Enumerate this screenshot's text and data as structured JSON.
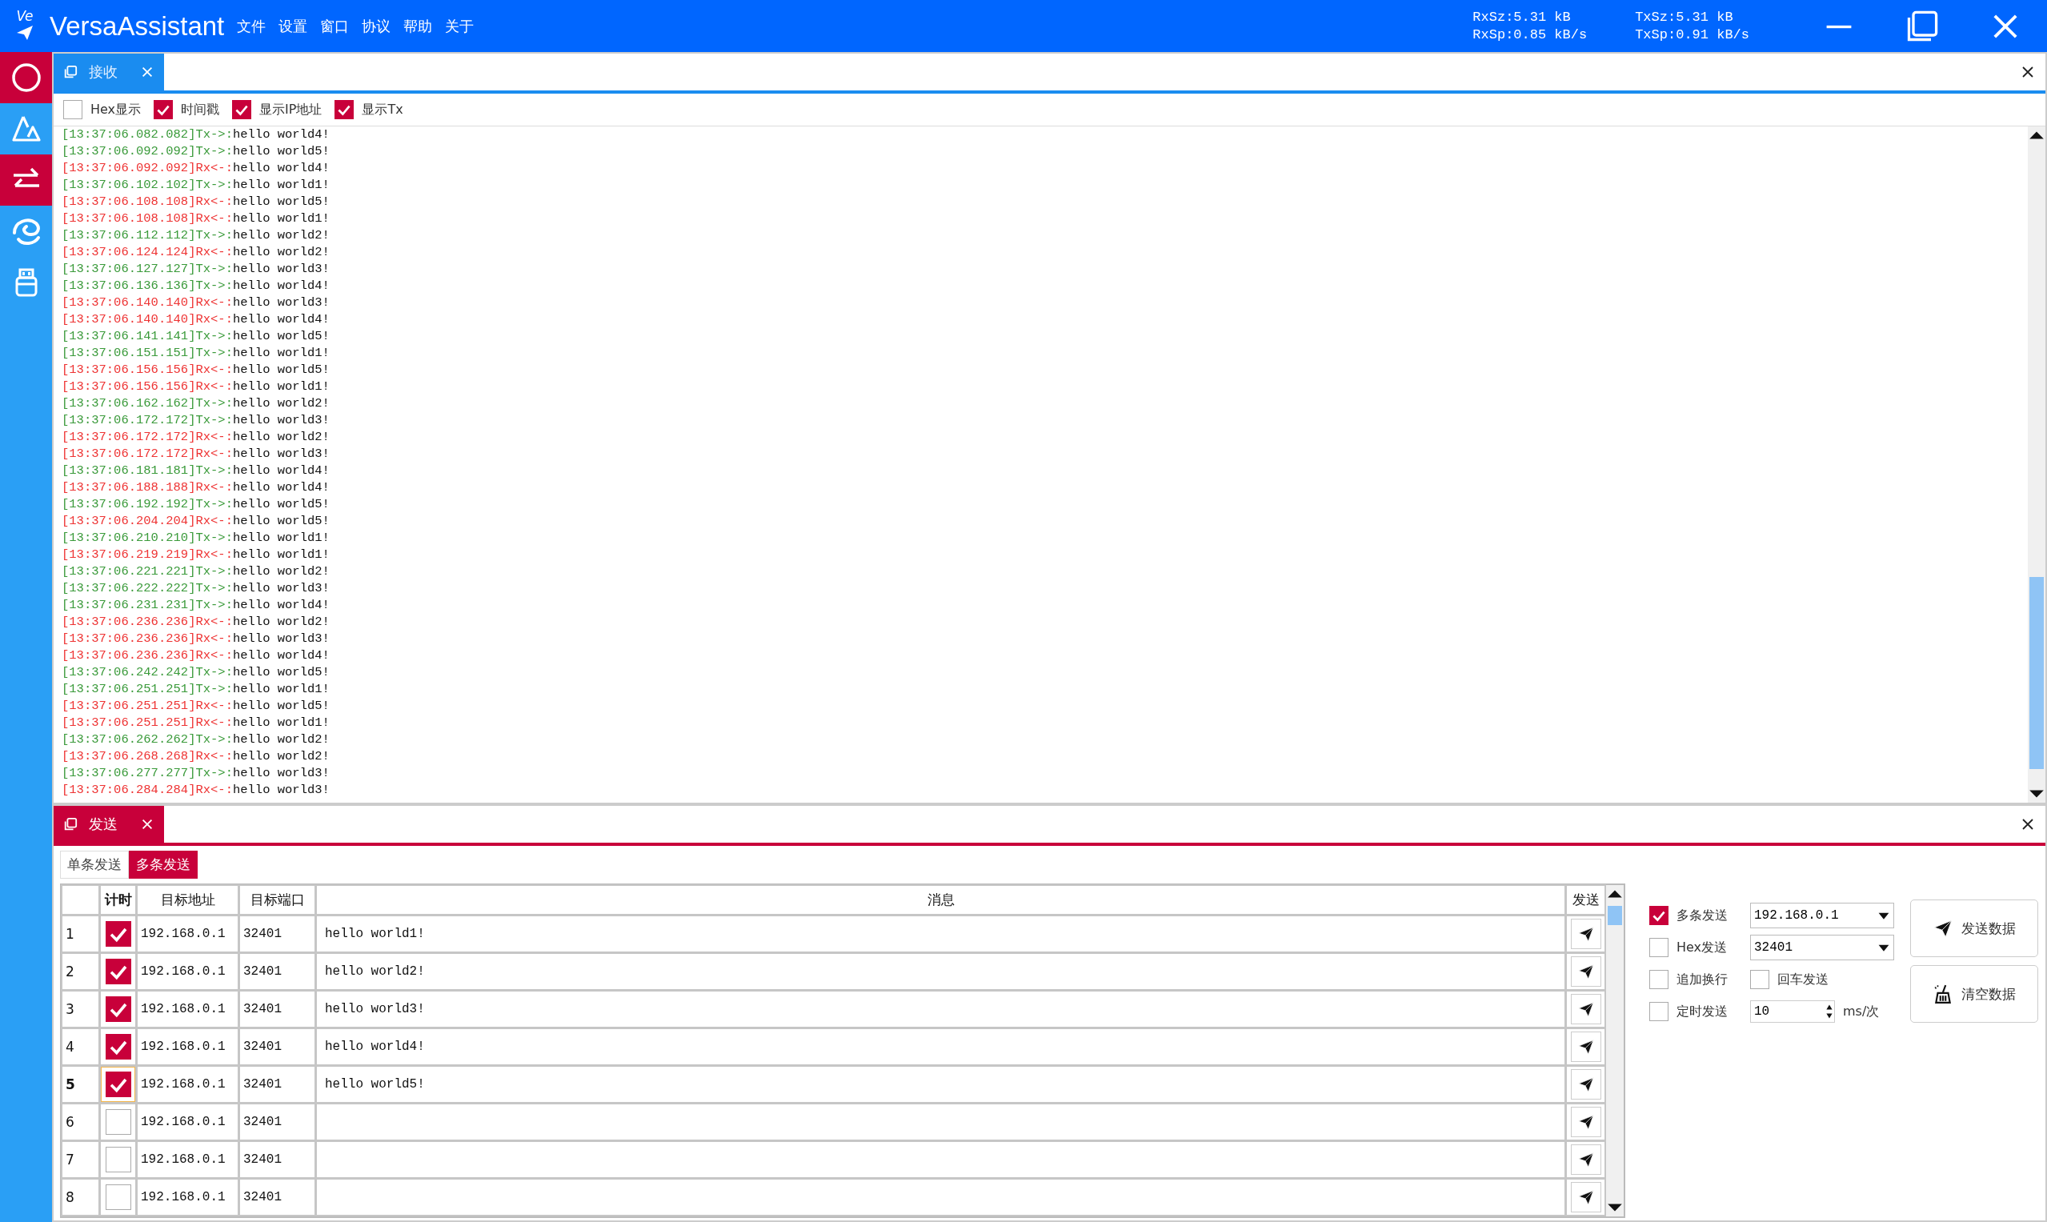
{
  "window": {
    "title": "VersaAssistant",
    "logo_text": "Ve"
  },
  "menu": [
    "文件",
    "设置",
    "窗口",
    "协议",
    "帮助",
    "关于"
  ],
  "stats": [
    {
      "lines": [
        "RxSz:5.31 kB",
        "RxSp:0.85 kB/s"
      ]
    },
    {
      "lines": [
        "TxSz:5.31 kB",
        "TxSp:0.91 kB/s"
      ]
    }
  ],
  "sidebar": {
    "items": [
      {
        "kind": "record",
        "selected": true
      },
      {
        "kind": "triangle",
        "selected": false
      },
      {
        "kind": "transfer",
        "selected": true
      },
      {
        "kind": "swirl",
        "selected": false
      },
      {
        "kind": "plug",
        "selected": false
      }
    ]
  },
  "receive": {
    "tab": {
      "label": "接收",
      "focused": false
    },
    "options": [
      {
        "label": "Hex显示",
        "checked": false
      },
      {
        "label": "时间戳",
        "checked": true
      },
      {
        "label": "显示IP地址",
        "checked": true
      },
      {
        "label": "显示Tx",
        "checked": true
      }
    ],
    "log": [
      {
        "kind": "tx",
        "stamp": "[13:37:06.082.082]Tx->:",
        "message": "hello world4!"
      },
      {
        "kind": "tx",
        "stamp": "[13:37:06.092.092]Tx->:",
        "message": "hello world5!"
      },
      {
        "kind": "rx",
        "stamp": "[13:37:06.092.092]Rx<-:",
        "message": "hello world4!"
      },
      {
        "kind": "tx",
        "stamp": "[13:37:06.102.102]Tx->:",
        "message": "hello world1!"
      },
      {
        "kind": "rx",
        "stamp": "[13:37:06.108.108]Rx<-:",
        "message": "hello world5!"
      },
      {
        "kind": "rx",
        "stamp": "[13:37:06.108.108]Rx<-:",
        "message": "hello world1!"
      },
      {
        "kind": "tx",
        "stamp": "[13:37:06.112.112]Tx->:",
        "message": "hello world2!"
      },
      {
        "kind": "rx",
        "stamp": "[13:37:06.124.124]Rx<-:",
        "message": "hello world2!"
      },
      {
        "kind": "tx",
        "stamp": "[13:37:06.127.127]Tx->:",
        "message": "hello world3!"
      },
      {
        "kind": "tx",
        "stamp": "[13:37:06.136.136]Tx->:",
        "message": "hello world4!"
      },
      {
        "kind": "rx",
        "stamp": "[13:37:06.140.140]Rx<-:",
        "message": "hello world3!"
      },
      {
        "kind": "rx",
        "stamp": "[13:37:06.140.140]Rx<-:",
        "message": "hello world4!"
      },
      {
        "kind": "tx",
        "stamp": "[13:37:06.141.141]Tx->:",
        "message": "hello world5!"
      },
      {
        "kind": "tx",
        "stamp": "[13:37:06.151.151]Tx->:",
        "message": "hello world1!"
      },
      {
        "kind": "rx",
        "stamp": "[13:37:06.156.156]Rx<-:",
        "message": "hello world5!"
      },
      {
        "kind": "rx",
        "stamp": "[13:37:06.156.156]Rx<-:",
        "message": "hello world1!"
      },
      {
        "kind": "tx",
        "stamp": "[13:37:06.162.162]Tx->:",
        "message": "hello world2!"
      },
      {
        "kind": "tx",
        "stamp": "[13:37:06.172.172]Tx->:",
        "message": "hello world3!"
      },
      {
        "kind": "rx",
        "stamp": "[13:37:06.172.172]Rx<-:",
        "message": "hello world2!"
      },
      {
        "kind": "rx",
        "stamp": "[13:37:06.172.172]Rx<-:",
        "message": "hello world3!"
      },
      {
        "kind": "tx",
        "stamp": "[13:37:06.181.181]Tx->:",
        "message": "hello world4!"
      },
      {
        "kind": "rx",
        "stamp": "[13:37:06.188.188]Rx<-:",
        "message": "hello world4!"
      },
      {
        "kind": "tx",
        "stamp": "[13:37:06.192.192]Tx->:",
        "message": "hello world5!"
      },
      {
        "kind": "rx",
        "stamp": "[13:37:06.204.204]Rx<-:",
        "message": "hello world5!"
      },
      {
        "kind": "tx",
        "stamp": "[13:37:06.210.210]Tx->:",
        "message": "hello world1!"
      },
      {
        "kind": "rx",
        "stamp": "[13:37:06.219.219]Rx<-:",
        "message": "hello world1!"
      },
      {
        "kind": "tx",
        "stamp": "[13:37:06.221.221]Tx->:",
        "message": "hello world2!"
      },
      {
        "kind": "tx",
        "stamp": "[13:37:06.222.222]Tx->:",
        "message": "hello world3!"
      },
      {
        "kind": "tx",
        "stamp": "[13:37:06.231.231]Tx->:",
        "message": "hello world4!"
      },
      {
        "kind": "rx",
        "stamp": "[13:37:06.236.236]Rx<-:",
        "message": "hello world2!"
      },
      {
        "kind": "rx",
        "stamp": "[13:37:06.236.236]Rx<-:",
        "message": "hello world3!"
      },
      {
        "kind": "rx",
        "stamp": "[13:37:06.236.236]Rx<-:",
        "message": "hello world4!"
      },
      {
        "kind": "tx",
        "stamp": "[13:37:06.242.242]Tx->:",
        "message": "hello world5!"
      },
      {
        "kind": "tx",
        "stamp": "[13:37:06.251.251]Tx->:",
        "message": "hello world1!"
      },
      {
        "kind": "rx",
        "stamp": "[13:37:06.251.251]Rx<-:",
        "message": "hello world5!"
      },
      {
        "kind": "rx",
        "stamp": "[13:37:06.251.251]Rx<-:",
        "message": "hello world1!"
      },
      {
        "kind": "tx",
        "stamp": "[13:37:06.262.262]Tx->:",
        "message": "hello world2!"
      },
      {
        "kind": "rx",
        "stamp": "[13:37:06.268.268]Rx<-:",
        "message": "hello world2!"
      },
      {
        "kind": "tx",
        "stamp": "[13:37:06.277.277]Tx->:",
        "message": "hello world3!"
      },
      {
        "kind": "rx",
        "stamp": "[13:37:06.284.284]Rx<-:",
        "message": "hello world3!"
      }
    ]
  },
  "send": {
    "tab": {
      "label": "发送",
      "focused": true
    },
    "modes": [
      {
        "label": "单条发送",
        "selected": false
      },
      {
        "label": "多条发送",
        "selected": true
      }
    ],
    "table": {
      "columns": [
        "计时",
        "目标地址",
        "目标端口",
        "消息",
        "发送"
      ],
      "rows": [
        {
          "index": "1",
          "timed": true,
          "address": "192.168.0.1",
          "port": "32401",
          "message": "hello world1!",
          "current": false
        },
        {
          "index": "2",
          "timed": true,
          "address": "192.168.0.1",
          "port": "32401",
          "message": "hello world2!",
          "current": false
        },
        {
          "index": "3",
          "timed": true,
          "address": "192.168.0.1",
          "port": "32401",
          "message": "hello world3!",
          "current": false
        },
        {
          "index": "4",
          "timed": true,
          "address": "192.168.0.1",
          "port": "32401",
          "message": "hello world4!",
          "current": false
        },
        {
          "index": "5",
          "timed": true,
          "address": "192.168.0.1",
          "port": "32401",
          "message": "hello world5!",
          "current": true
        },
        {
          "index": "6",
          "timed": false,
          "address": "192.168.0.1",
          "port": "32401",
          "current": false
        },
        {
          "index": "7",
          "timed": false,
          "address": "192.168.0.1",
          "port": "32401",
          "current": false
        },
        {
          "index": "8",
          "timed": false,
          "address": "192.168.0.1",
          "port": "32401",
          "current": false
        }
      ]
    },
    "options": {
      "checks": [
        {
          "label": "多条发送",
          "checked": true
        },
        {
          "label": "Hex发送",
          "checked": false
        },
        {
          "label": "追加换行",
          "checked": false
        },
        {
          "label": "回车发送",
          "checked": false
        },
        {
          "label": "定时发送",
          "checked": false
        }
      ],
      "address": "192.168.0.1",
      "port": "32401",
      "interval": "10",
      "interval_unit": "ms/次",
      "buttons": [
        {
          "label": "发送数据",
          "kind": "send"
        },
        {
          "label": "清空数据",
          "kind": "clear"
        }
      ]
    }
  }
}
